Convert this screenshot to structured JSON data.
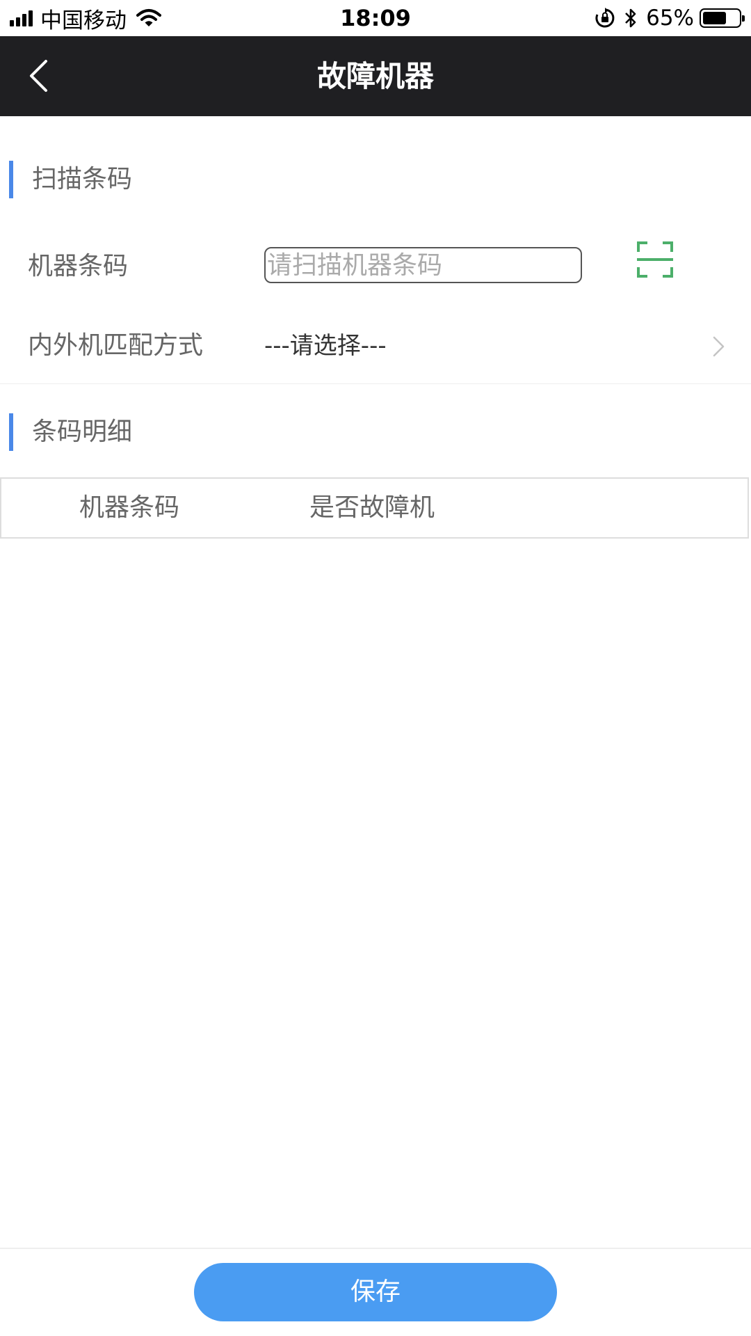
{
  "status_bar": {
    "carrier": "中国移动",
    "time": "18:09",
    "battery_percent": "65%",
    "battery_level": 0.65,
    "icons": [
      "signal-icon",
      "wifi-icon",
      "rotation-lock-icon",
      "bluetooth-icon",
      "battery-icon"
    ]
  },
  "nav": {
    "title": "故障机器",
    "back_icon": "chevron-left-icon"
  },
  "scan_section": {
    "title": "扫描条码"
  },
  "form": {
    "barcode_label": "机器条码",
    "barcode_placeholder": "请扫描机器条码",
    "barcode_value": "",
    "scan_icon": "scan-frame-icon",
    "match_label": "内外机匹配方式",
    "match_value": "---请选择---"
  },
  "detail_section": {
    "title": "条码明细"
  },
  "table": {
    "columns": [
      "机器条码",
      "是否故障机"
    ],
    "rows": []
  },
  "footer": {
    "save_label": "保存"
  },
  "colors": {
    "nav_bg": "#1f1f22",
    "accent": "#4a88e8",
    "save_button": "#4a9cf2",
    "scan_icon": "#4caf6a"
  }
}
